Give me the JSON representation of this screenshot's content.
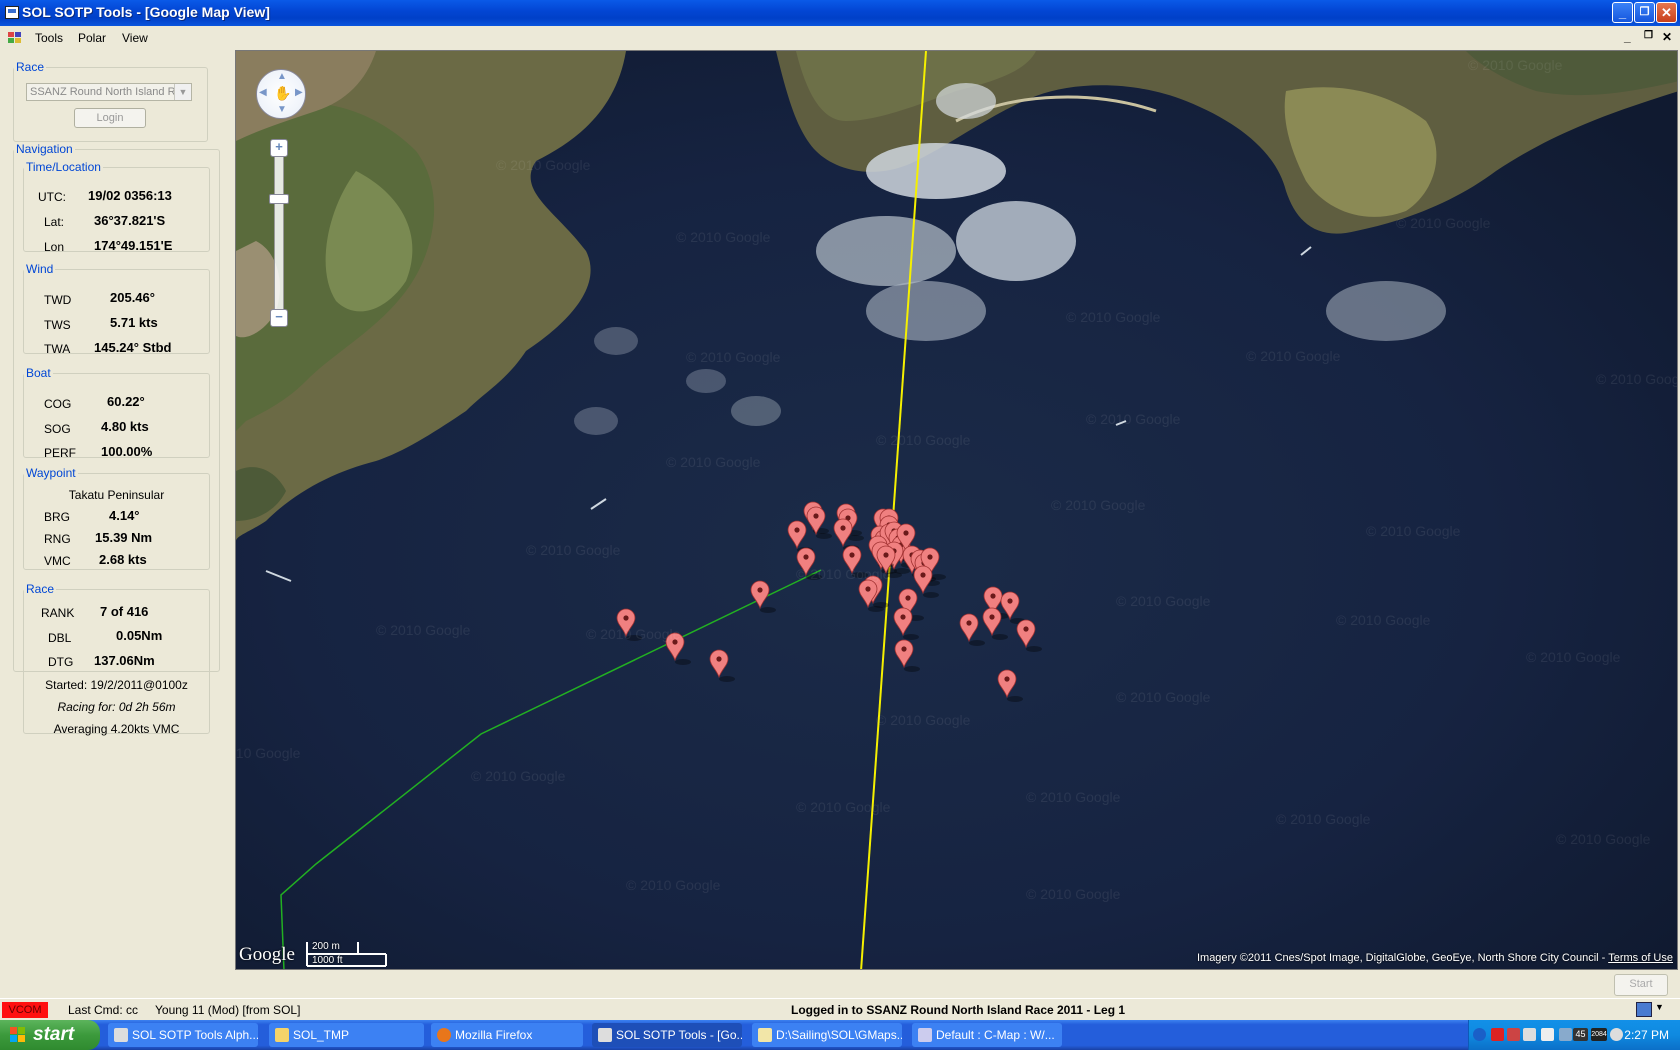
{
  "window": {
    "title": "SOL SOTP Tools - [Google Map View]"
  },
  "menu": {
    "items": [
      "Tools",
      "Polar",
      "View"
    ]
  },
  "race_panel": {
    "legend": "Race",
    "combo_value": "SSANZ Round North Island R",
    "login_label": "Login"
  },
  "navigation": {
    "legend": "Navigation",
    "time_location": {
      "legend": "Time/Location",
      "utc_label": "UTC:",
      "utc_value": "19/02 0356:13",
      "lat_label": "Lat:",
      "lat_value": "36°37.821'S",
      "lon_label": "Lon",
      "lon_value": "174°49.151'E"
    },
    "wind": {
      "legend": "Wind",
      "twd_label": "TWD",
      "twd_value": "205.46°",
      "tws_label": "TWS",
      "tws_value": "5.71 kts",
      "twa_label": "TWA",
      "twa_value": "145.24° Stbd"
    },
    "boat": {
      "legend": "Boat",
      "cog_label": "COG",
      "cog_value": "60.22°",
      "sog_label": "SOG",
      "sog_value": "4.80 kts",
      "perf_label": "PERF",
      "perf_value": "100.00%"
    },
    "waypoint": {
      "legend": "Waypoint",
      "name": "Takatu Peninsular",
      "brg_label": "BRG",
      "brg_value": "4.14°",
      "rng_label": "RNG",
      "rng_value": "15.39 Nm",
      "vmc_label": "VMC",
      "vmc_value": "2.68 kts"
    }
  },
  "race": {
    "legend": "Race",
    "rank_label": "RANK",
    "rank_value": "7 of 416",
    "dbl_label": "DBL",
    "dbl_value": "0.05Nm",
    "dtg_label": "DTG",
    "dtg_value": "137.06Nm",
    "started": "Started: 19/2/2011@0100z",
    "racing_for": "Racing for: 0d 2h 56m",
    "averaging": "Averaging 4.20kts VMC"
  },
  "map": {
    "watermark": "© 2010 Google",
    "logo": "Google",
    "scale_metric": "200 m",
    "scale_imperial": "1000 ft",
    "attribution": "Imagery ©2011 Cnes/Spot Image, DigitalGlobe, GeoEye, North Shore City Council - ",
    "terms_link": "Terms of Use",
    "colors": {
      "heading_line": "#f5f000",
      "track_line": "#22b022",
      "marker": "#f08080",
      "sea": "#15203a"
    }
  },
  "start_button": "Start",
  "status_bar": {
    "vcom": "VCOM",
    "last_cmd": "Last Cmd: cc",
    "user": "Young 11 (Mod) [from SOL]",
    "message": "Logged in to SSANZ Round North Island Race 2011 - Leg 1"
  },
  "taskbar": {
    "start_label": "start",
    "tasks": [
      "SOL SOTP Tools Alph...",
      "SOL_TMP",
      "Mozilla Firefox",
      "SOL SOTP Tools - [Go...",
      "D:\\Sailing\\SOL\\GMaps...",
      "Default : C-Map : W/..."
    ],
    "clock": "2:27 PM",
    "tray_badges": [
      "45",
      "2084"
    ]
  }
}
